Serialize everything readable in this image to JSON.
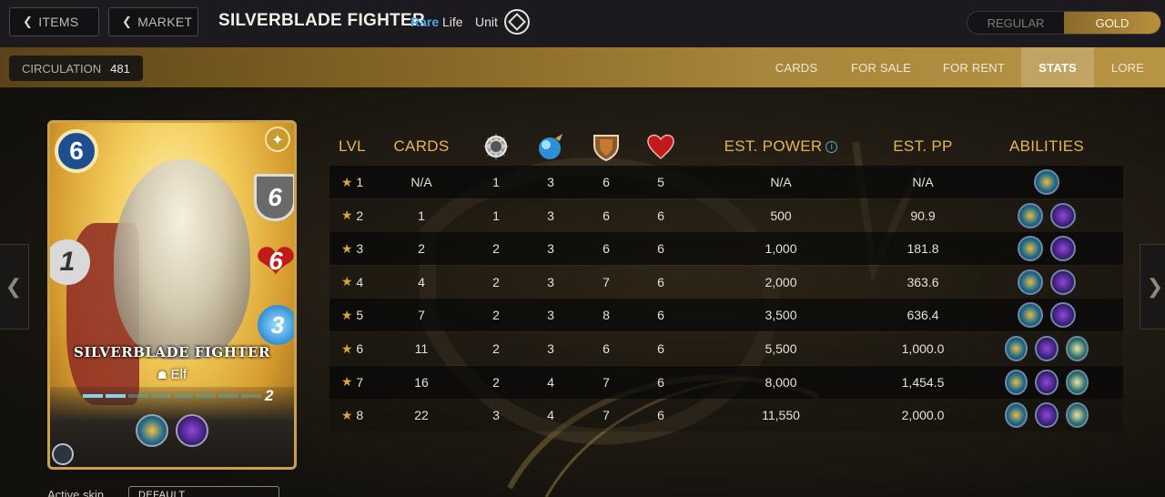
{
  "nav": {
    "items_label": "ITEMS",
    "market_label": "MARKET"
  },
  "card": {
    "name": "SILVERBLADE FIGHTER",
    "rarity": "Rare",
    "element": "Life",
    "type": "Unit",
    "mana": "6",
    "armor": "6",
    "health": "6",
    "melee": "1",
    "magic": "3",
    "race": "Elf",
    "level": "2",
    "xp_segments_filled": 2,
    "xp_segments_total": 8
  },
  "edition_toggle": {
    "regular": "REGULAR",
    "gold": "GOLD",
    "selected": "GOLD"
  },
  "circulation": {
    "label": "CIRCULATION",
    "value": "481"
  },
  "tabs": [
    "CARDS",
    "FOR SALE",
    "FOR RENT",
    "STATS",
    "LORE"
  ],
  "active_tab": "STATS",
  "stats_table": {
    "headers": {
      "lvl": "LVL",
      "cards": "CARDS",
      "melee_icon": "melee-attack-icon",
      "magic_icon": "magic-attack-icon",
      "armor_icon": "armor-icon",
      "health_icon": "health-icon",
      "est_power": "EST. POWER",
      "est_pp": "EST. PP",
      "abilities": "ABILITIES"
    },
    "rows": [
      {
        "lvl": "1",
        "cards": "N/A",
        "melee": "1",
        "magic": "3",
        "armor": "6",
        "health": "5",
        "power": "N/A",
        "pp": "N/A",
        "abilities": [
          "ability-a"
        ]
      },
      {
        "lvl": "2",
        "cards": "1",
        "melee": "1",
        "magic": "3",
        "armor": "6",
        "health": "6",
        "power": "500",
        "pp": "90.9",
        "abilities": [
          "ability-a",
          "ability-b"
        ]
      },
      {
        "lvl": "3",
        "cards": "2",
        "melee": "2",
        "magic": "3",
        "armor": "6",
        "health": "6",
        "power": "1,000",
        "pp": "181.8",
        "abilities": [
          "ability-a",
          "ability-b"
        ]
      },
      {
        "lvl": "4",
        "cards": "4",
        "melee": "2",
        "magic": "3",
        "armor": "7",
        "health": "6",
        "power": "2,000",
        "pp": "363.6",
        "abilities": [
          "ability-a",
          "ability-b"
        ]
      },
      {
        "lvl": "5",
        "cards": "7",
        "melee": "2",
        "magic": "3",
        "armor": "8",
        "health": "6",
        "power": "3,500",
        "pp": "636.4",
        "abilities": [
          "ability-a",
          "ability-b"
        ]
      },
      {
        "lvl": "6",
        "cards": "11",
        "melee": "2",
        "magic": "3",
        "armor": "6",
        "health": "6",
        "power": "5,500",
        "pp": "1,000.0",
        "abilities": [
          "ability-a",
          "ability-b",
          "ability-c"
        ]
      },
      {
        "lvl": "7",
        "cards": "16",
        "melee": "2",
        "magic": "4",
        "armor": "7",
        "health": "6",
        "power": "8,000",
        "pp": "1,454.5",
        "abilities": [
          "ability-a",
          "ability-b",
          "ability-c"
        ]
      },
      {
        "lvl": "8",
        "cards": "22",
        "melee": "3",
        "magic": "4",
        "armor": "7",
        "health": "6",
        "power": "11,550",
        "pp": "2,000.0",
        "abilities": [
          "ability-a",
          "ability-b",
          "ability-c"
        ]
      }
    ]
  },
  "active_skin": {
    "label": "Active skin",
    "value": "DEFAULT"
  },
  "colors": {
    "accent_gold": "#e4b558",
    "rarity_blue": "#4aa8e8",
    "star": "#e0a23a"
  }
}
